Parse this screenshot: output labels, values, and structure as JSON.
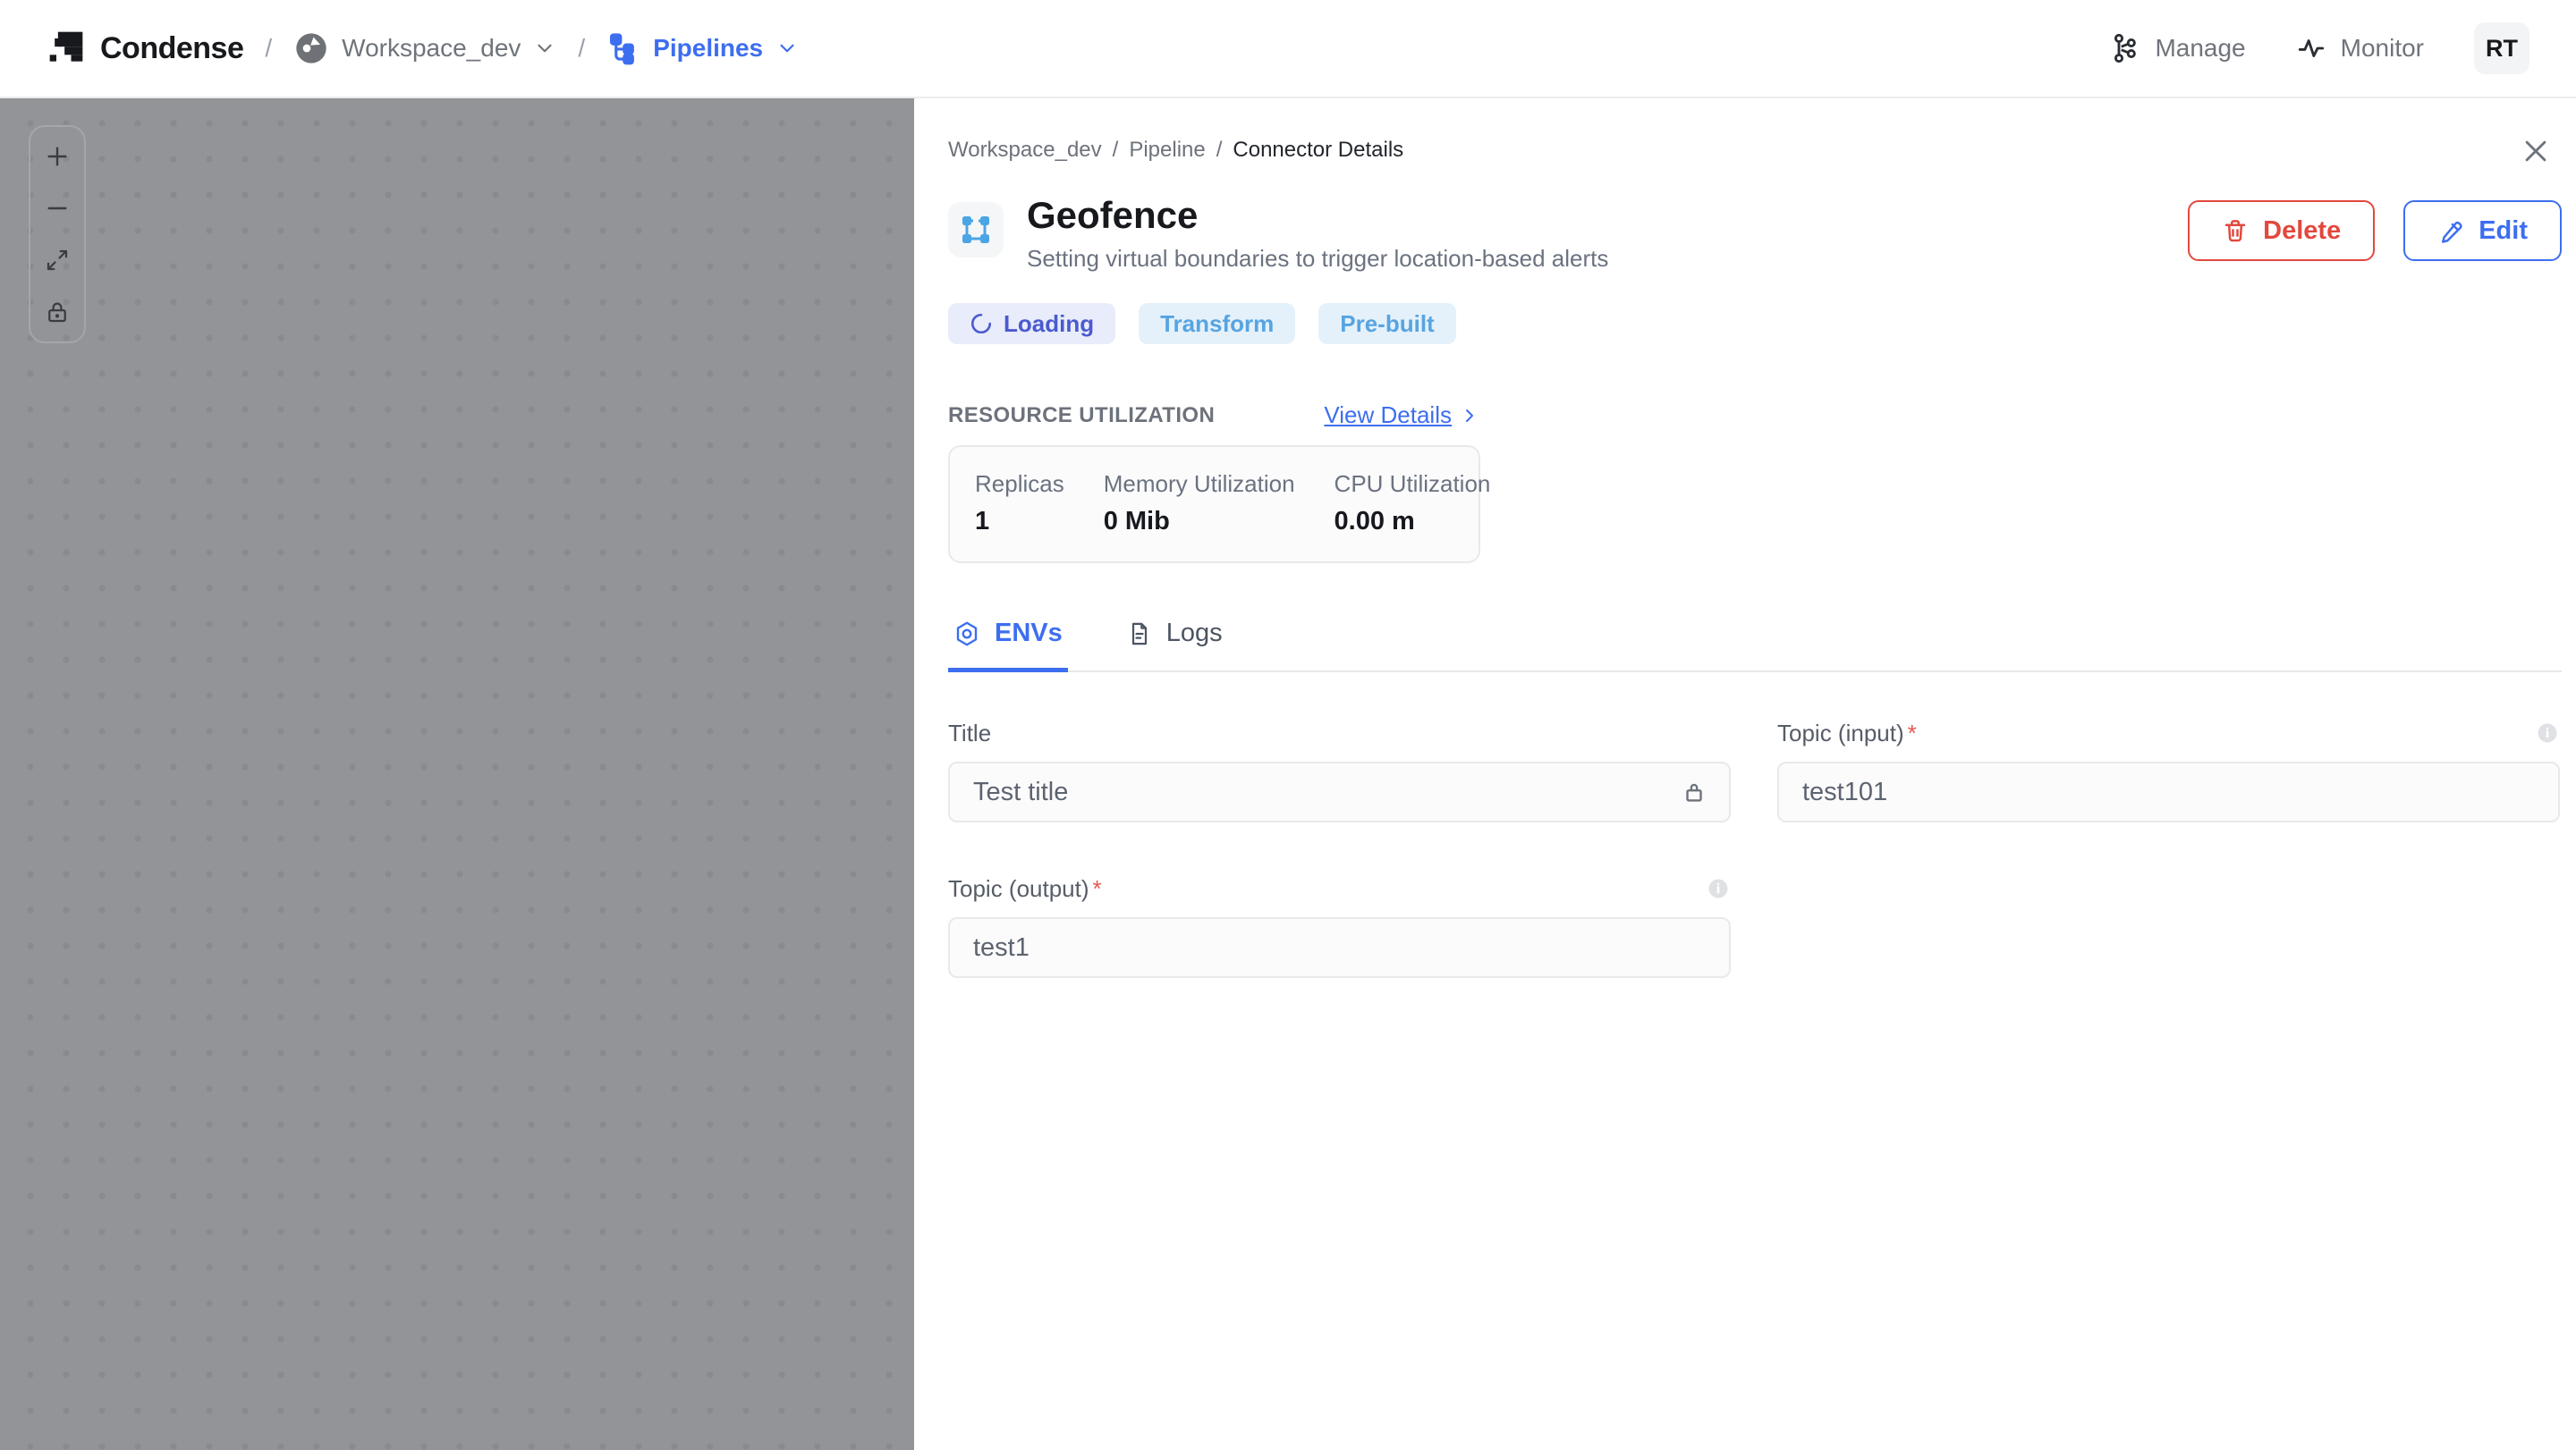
{
  "navbar": {
    "brand": "Condense",
    "separator": "/",
    "workspace": "Workspace_dev",
    "section": "Pipelines",
    "manage_label": "Manage",
    "monitor_label": "Monitor",
    "avatar_initials": "RT"
  },
  "canvas": {
    "controls": [
      "zoom-in",
      "zoom-out",
      "fit-view",
      "lock"
    ]
  },
  "panel": {
    "breadcrumb": {
      "separator": "/",
      "items": [
        "Workspace_dev",
        "Pipeline",
        "Connector Details"
      ]
    },
    "header": {
      "title": "Geofence",
      "subtitle": "Setting virtual boundaries to trigger location-based alerts",
      "delete_label": "Delete",
      "edit_label": "Edit"
    },
    "badges": [
      {
        "label": "Loading",
        "variant": "indigo",
        "spinner": true
      },
      {
        "label": "Transform",
        "variant": "lightblue",
        "spinner": false
      },
      {
        "label": "Pre-built",
        "variant": "lightblue",
        "spinner": false
      }
    ],
    "resource": {
      "heading": "RESOURCE UTILIZATION",
      "link_label": "View Details",
      "stats": [
        {
          "label": "Replicas",
          "value": "1"
        },
        {
          "label": "Memory Utilization",
          "value": "0 Mib"
        },
        {
          "label": "CPU Utilization",
          "value": "0.00 m"
        }
      ]
    },
    "tabs": [
      {
        "label": "ENVs",
        "active": true
      },
      {
        "label": "Logs",
        "active": false
      }
    ],
    "form": {
      "fields": [
        {
          "label": "Title",
          "value": "Test title",
          "required": false,
          "locked": true
        },
        {
          "label": "Topic (input)",
          "value": "test101",
          "required": true,
          "info": true
        },
        {
          "label": "Topic (output)",
          "value": "test1",
          "required": true,
          "info": true
        }
      ],
      "required_marker": "*"
    }
  },
  "colors": {
    "accent_blue": "#3d6ef0",
    "badge_indigo_text": "#4a5ad0",
    "badge_indigo_bg": "#e9ecfa",
    "badge_blue_text": "#57a4e1",
    "badge_blue_bg": "#e4f1fb",
    "danger_red": "#e2483e",
    "canvas_gray": "#939498",
    "geofence_icon_blue": "#4ba5e5"
  },
  "icons": {
    "navbar": [
      "condense-logo",
      "workspace-avatar",
      "pipelines-tree",
      "kafka-manage",
      "activity-monitor"
    ],
    "panel": [
      "close",
      "geofence",
      "trash",
      "pencil",
      "spinner",
      "hex-nut",
      "document",
      "lock",
      "info",
      "chevron-right"
    ]
  }
}
